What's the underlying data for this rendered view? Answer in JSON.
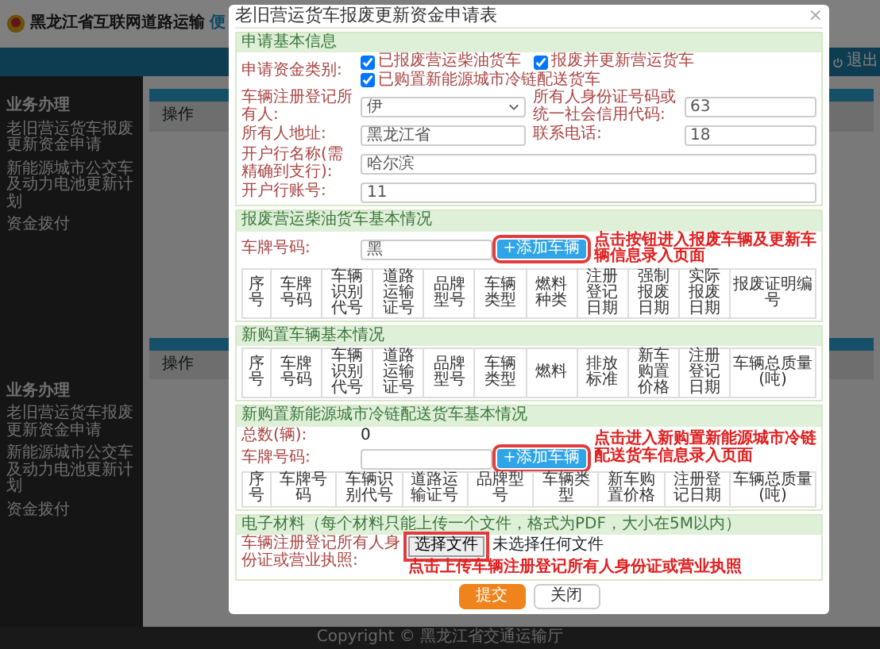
{
  "site": {
    "title": "黑龙江省互联网道路运输",
    "title_cut": "便",
    "logout": "退出"
  },
  "sidebar": [
    {
      "heading": "业务办理",
      "items": [
        "老旧营运货车报废更新资金申请",
        "新能源城市公交车及动力电池更新计划",
        "资金拨付"
      ]
    },
    {
      "heading": "业务办理",
      "items": [
        "老旧营运货车报废更新资金申请",
        "新能源城市公交车及动力电池更新计划",
        "资金拨付"
      ]
    }
  ],
  "background_tables": [
    {
      "columns": [
        "操作"
      ]
    },
    {
      "columns": [
        "操作"
      ]
    }
  ],
  "footer": "Copyright © 黑龙江省交通运输厅",
  "modal": {
    "title": "老旧营运货车报废更新资金申请表",
    "close": "×",
    "sections": [
      {
        "kind": "form",
        "title": "申请基本信息",
        "category_label": "申请资金类别:",
        "options": [
          {
            "label": "已报废营运柴油货车",
            "checked": true
          },
          {
            "label": "报废并更新营运货车",
            "checked": true
          },
          {
            "label": "已购置新能源城市冷链配送货车",
            "checked": true
          }
        ],
        "rows": [
          [
            {
              "label": "车辆注册登记所有人:",
              "kind": "select",
              "value": "伊"
            },
            {
              "label": "所有人身份证号码或统一社会信用代码:",
              "kind": "input",
              "value": "63"
            }
          ],
          [
            {
              "label": "所有人地址:",
              "kind": "input",
              "value": "黑龙江省"
            },
            {
              "label": "联系电话:",
              "kind": "input",
              "value": "18"
            }
          ],
          [
            {
              "label": "开户行名称(需精确到支行):",
              "kind": "input",
              "value": "哈尔滨"
            }
          ],
          [
            {
              "label": "开户行账号:",
              "kind": "input",
              "value": "11"
            }
          ]
        ]
      },
      {
        "kind": "vehicles",
        "title": "报废营运柴油货车基本情况",
        "plate_label": "车牌号码:",
        "plate_value": "黑",
        "button": "+添加车辆",
        "annotation": "点击按钮进入报废车辆及更新车辆信息录入页面",
        "columns": [
          "序号",
          "车牌号码",
          "车辆识别代号",
          "道路运输证号",
          "品牌型号",
          "车辆类型",
          "燃料种类",
          "注册登记日期",
          "强制报废日期",
          "实际报废日期",
          "报废证明编号"
        ]
      },
      {
        "kind": "vehicles",
        "title": "新购置车辆基本情况",
        "columns": [
          "序号",
          "车牌号码",
          "车辆识别代号",
          "道路运输证号",
          "品牌型号",
          "车辆类型",
          "燃料",
          "排放标准",
          "新车购置价格",
          "注册登记日期",
          "车辆总质量(吨)"
        ]
      },
      {
        "kind": "vehicles",
        "title": "新购置新能源城市冷链配送货车基本情况",
        "count_label": "总数(辆):",
        "count": "0",
        "plate_label": "车牌号码:",
        "button": "+添加车辆",
        "annotation": "点击进入新购置新能源城市冷链配送货车信息录入页面",
        "columns": [
          "序号",
          "车牌号码",
          "车辆识别代号",
          "道路运输证号",
          "品牌型号",
          "车辆类型",
          "新车购置价格",
          "注册登记日期",
          "车辆总质量(吨)"
        ]
      },
      {
        "kind": "upload",
        "title": "电子材料（每个材料只能上传一个文件，格式为PDF，大小在5M以内）",
        "label": "车辆注册登记所有人身份证或营业执照:",
        "button": "选择文件",
        "file_status": "未选择任何文件",
        "annotation": "点击上传车辆注册登记所有人身份证或营业执照"
      }
    ],
    "buttons": [
      {
        "label": "提交",
        "kind": "primary"
      },
      {
        "label": "关闭",
        "kind": "secondary"
      }
    ]
  }
}
